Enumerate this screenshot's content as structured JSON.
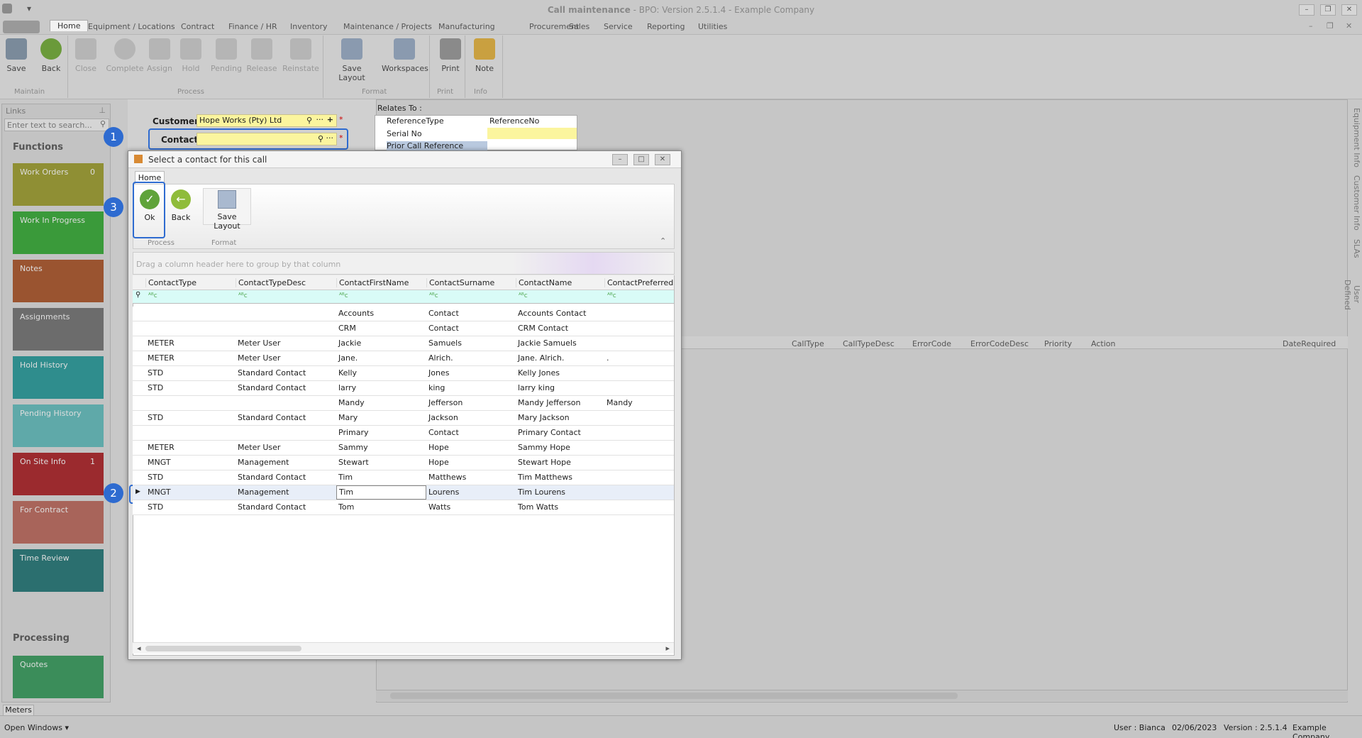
{
  "window": {
    "title": "Call maintenance",
    "subtitle": "BPO: Version 2.5.1.4 - Example Company"
  },
  "menu": [
    "Home",
    "Equipment / Locations",
    "Contract",
    "Finance / HR",
    "Inventory",
    "Maintenance / Projects",
    "Manufacturing",
    "Procurement",
    "Sales",
    "Service",
    "Reporting",
    "Utilities"
  ],
  "ribbon": {
    "buttons": [
      "Save",
      "Back",
      "Close",
      "Complete",
      "Assign",
      "Hold",
      "Pending",
      "Release",
      "Reinstate",
      "Save Layout",
      "Workspaces",
      "Print",
      "Note"
    ],
    "groups": [
      "Maintain",
      "Process",
      "Format",
      "Print",
      "Info"
    ]
  },
  "links": {
    "title": "Links",
    "search_placeholder": "Enter text to search...",
    "functions_label": "Functions",
    "processing_label": "Processing",
    "tiles": [
      {
        "label": "Work Orders",
        "count": "0",
        "color": "#8f8f34"
      },
      {
        "label": "Work In Progress",
        "count": "",
        "color": "#3a9a3a"
      },
      {
        "label": "Notes",
        "count": "",
        "color": "#9a5430"
      },
      {
        "label": "Assignments",
        "count": "",
        "color": "#6c6c6c"
      },
      {
        "label": "Hold History",
        "count": "",
        "color": "#2f8d8d"
      },
      {
        "label": "Pending History",
        "count": "",
        "color": "#5fa9a9"
      },
      {
        "label": "On Site Info",
        "count": "1",
        "color": "#9b2a2e"
      },
      {
        "label": "For Contract",
        "count": "",
        "color": "#a8645a"
      },
      {
        "label": "Time Review",
        "count": "",
        "color": "#2b6f6f"
      }
    ],
    "quotes": {
      "label": "Quotes",
      "color": "#3b8d5a"
    }
  },
  "form": {
    "customer_label": "Customer",
    "customer_value": "Hope Works (Pty) Ltd",
    "contact_label": "Contact",
    "contact_value": "",
    "relates_label": "Relates To :",
    "ref_headers": [
      "ReferenceType",
      "ReferenceNo"
    ],
    "ref_rows": [
      "Serial No",
      "Prior Call Reference"
    ]
  },
  "dialog": {
    "title": "Select a contact for this call",
    "tab": "Home",
    "ok": "Ok",
    "back": "Back",
    "save_layout": "Save Layout",
    "group_process": "Process",
    "group_format": "Format",
    "group_hint": "Drag a column header here to group by that column",
    "columns": [
      "ContactType",
      "ContactTypeDesc",
      "ContactFirstName",
      "ContactSurname",
      "ContactName",
      "ContactPreferredNa"
    ],
    "rows": [
      [
        "",
        "",
        "Accounts",
        "Contact",
        "Accounts Contact",
        ""
      ],
      [
        "",
        "",
        "CRM",
        "Contact",
        "CRM Contact",
        ""
      ],
      [
        "METER",
        "Meter User",
        "Jackie",
        "Samuels",
        "Jackie Samuels",
        ""
      ],
      [
        "METER",
        "Meter User",
        "Jane.",
        "Alrich.",
        "Jane. Alrich.",
        "."
      ],
      [
        "STD",
        "Standard Contact",
        "Kelly",
        "Jones",
        "Kelly Jones",
        ""
      ],
      [
        "STD",
        "Standard Contact",
        "larry",
        "king",
        "larry king",
        ""
      ],
      [
        "",
        "",
        "Mandy",
        "Jefferson",
        "Mandy Jefferson",
        "Mandy"
      ],
      [
        "STD",
        "Standard Contact",
        "Mary",
        "Jackson",
        "Mary Jackson",
        ""
      ],
      [
        "",
        "",
        "Primary",
        "Contact",
        "Primary Contact",
        ""
      ],
      [
        "METER",
        "Meter User",
        "Sammy",
        "Hope",
        "Sammy Hope",
        ""
      ],
      [
        "MNGT",
        "Management",
        "Stewart",
        "Hope",
        "Stewart Hope",
        ""
      ],
      [
        "STD",
        "Standard Contact",
        "Tim",
        " Matthews",
        "Tim  Matthews",
        ""
      ],
      [
        "MNGT",
        "Management",
        "Tim",
        "Lourens",
        "Tim Lourens",
        ""
      ],
      [
        "STD",
        "Standard Contact",
        "Tom",
        "Watts",
        "Tom Watts",
        ""
      ]
    ]
  },
  "bg_grid": {
    "columns": [
      "CallType",
      "CallTypeDesc",
      "ErrorCode",
      "ErrorCodeDesc",
      "Priority",
      "Action",
      "DateRequired"
    ]
  },
  "side_tabs": [
    "Equipment Info",
    "Customer Info",
    "SLAs",
    "User Defined"
  ],
  "badges": [
    "1",
    "2",
    "3"
  ],
  "meters_tab": "Meters",
  "status": {
    "open_windows": "Open Windows",
    "user": "User : Bianca",
    "date": "02/06/2023",
    "version": "Version : 2.5.1.4",
    "company": "Example Company"
  }
}
